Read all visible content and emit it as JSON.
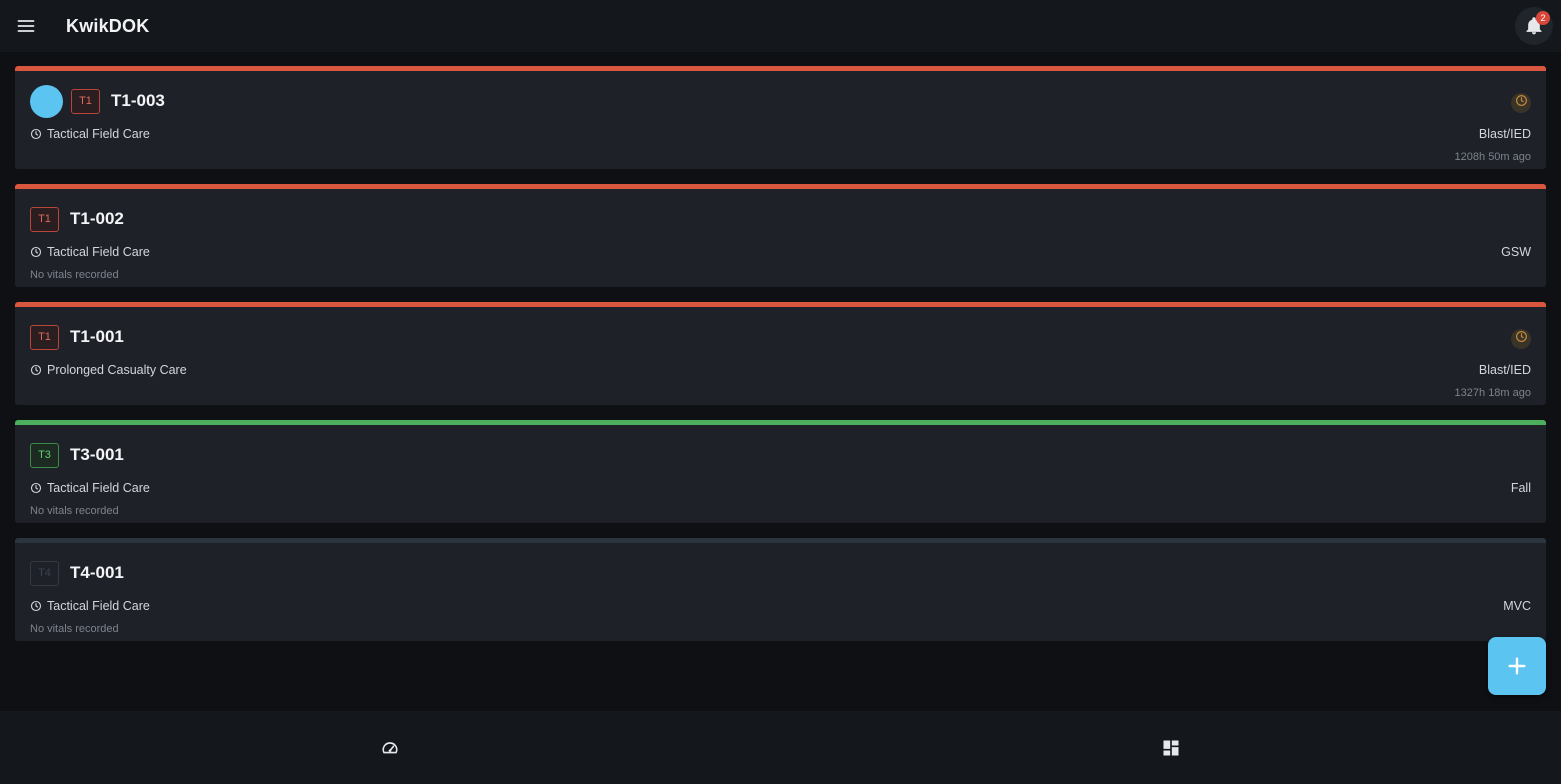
{
  "app": {
    "title": "KwikDOK",
    "notification_count": "2"
  },
  "colors": {
    "t1": "#d9573f",
    "t3": "#4caf5e",
    "t4": "#2c3440",
    "accent": "#5cc4f1"
  },
  "casualties": [
    {
      "id": "T1-003",
      "tag": "T1",
      "category": "t1",
      "has_avatar": true,
      "phase": "Tactical Field Care",
      "mechanism": "Blast/IED",
      "note": "1208h 50m ago",
      "note_align": "right",
      "status_icon": "clock-icon"
    },
    {
      "id": "T1-002",
      "tag": "T1",
      "category": "t1",
      "has_avatar": false,
      "phase": "Tactical Field Care",
      "mechanism": "GSW",
      "note": "No vitals recorded",
      "note_align": "left",
      "status_icon": null
    },
    {
      "id": "T1-001",
      "tag": "T1",
      "category": "t1",
      "has_avatar": false,
      "phase": "Prolonged Casualty Care",
      "mechanism": "Blast/IED",
      "note": "1327h 18m ago",
      "note_align": "right",
      "status_icon": "clock-icon"
    },
    {
      "id": "T3-001",
      "tag": "T3",
      "category": "t3",
      "has_avatar": false,
      "phase": "Tactical Field Care",
      "mechanism": "Fall",
      "note": "No vitals recorded",
      "note_align": "left",
      "status_icon": null
    },
    {
      "id": "T4-001",
      "tag": "T4",
      "category": "t4",
      "has_avatar": false,
      "phase": "Tactical Field Care",
      "mechanism": "MVC",
      "note": "No vitals recorded",
      "note_align": "left",
      "status_icon": null
    }
  ],
  "icons": {
    "menu": "menu-icon",
    "bell": "bell-icon",
    "add": "plus-icon",
    "nav_dashboard": "speedometer-icon",
    "nav_grid": "dashboard-grid-icon"
  }
}
